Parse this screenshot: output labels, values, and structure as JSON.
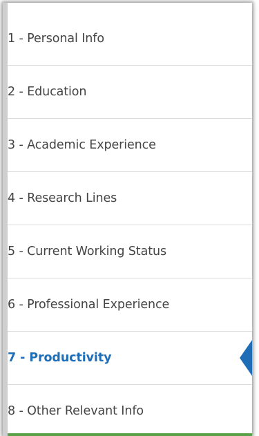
{
  "nav": {
    "items": [
      {
        "label": "1 - Personal Info",
        "active": false
      },
      {
        "label": "2 - Education",
        "active": false
      },
      {
        "label": "3 - Academic Experience",
        "active": false
      },
      {
        "label": "4 - Research Lines",
        "active": false
      },
      {
        "label": "5 - Current Working Status",
        "active": false
      },
      {
        "label": "6 - Professional Experience",
        "active": false
      },
      {
        "label": "7 - Productivity",
        "active": true
      },
      {
        "label": "8 - Other Relevant Info",
        "active": false
      }
    ]
  },
  "colors": {
    "active_text": "#1f6db7",
    "active_marker": "#1f6db7",
    "text": "#444444",
    "bottom_accent": "#5aa24a"
  }
}
